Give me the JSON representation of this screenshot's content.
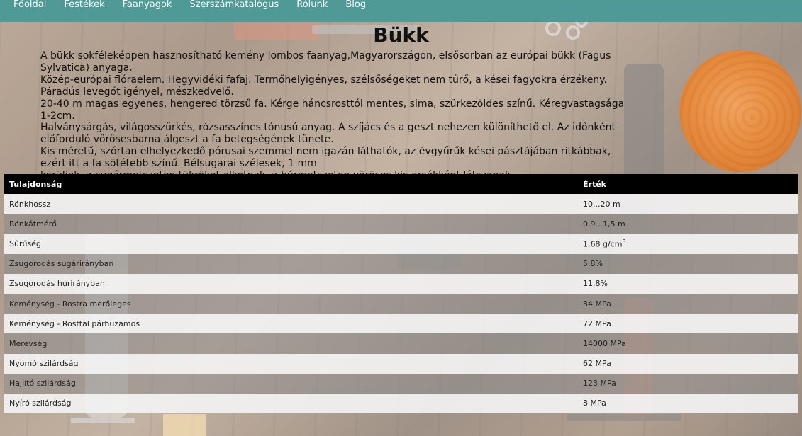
{
  "nav": {
    "items": [
      "Főoldal",
      "Festékek",
      "Faanyagok",
      "Szerszámkatalógus",
      "Rólunk",
      "Blog"
    ]
  },
  "colors": {
    "navbar": "#4f9a96",
    "table_header": "#000000",
    "wood_disc": "#e58a3c"
  },
  "page": {
    "title": "Bükk",
    "paragraphs": [
      "A bükk sokféleképpen hasznosítható kemény lombos faanyag,Magyarországon, elsősorban az európai bükk (Fagus Sylvatica) anyaga.",
      "Közép-európai flóraelem. Hegyvidéki fafaj. Termőhelyigényes, szélsőségeket nem tűrő, a kései fagyokra érzékeny. Páradús levegőt igényel, mészkedvelő.",
      "20-40 m magas egyenes, hengered törzsű fa. Kérge háncsrosttól mentes, sima, szürkezöldes színű. Kéregvastagsága 1-2cm.",
      "Halványsárgás, világosszürkés, rózsasszínes tónusú anyag. A szíjács és a geszt nehezen különíthető el. Az időnként előforduló vörösesbarna álgeszt a fa betegségének tünete.",
      "Kis méretű, szórtan elhelyezkedő pórusai szemmel nem igazán láthatók, az évgyűrűk kései pásztájában ritkábbak, ezért itt a fa sötétebb színű. Bélsugarai szélesek, 1 mm",
      "körüliek, a sugármetszeten tükröket alkotnak, a húrmetszeten vöröses kis orsókként látszanak."
    ],
    "image_alt": "beech-wood-cross-section"
  },
  "table": {
    "headers": [
      "Tulajdonság",
      "Érték"
    ],
    "rows": [
      {
        "prop": "Rönkhossz",
        "value": "10...20 m",
        "sup": ""
      },
      {
        "prop": "Rönkátmérő",
        "value": "0,9...1,5 m",
        "sup": ""
      },
      {
        "prop": "Sűrűség",
        "value": "1,68 g/cm",
        "sup": "3"
      },
      {
        "prop": "Zsugorodás sugárirányban",
        "value": "5,8%",
        "sup": ""
      },
      {
        "prop": "Zsugorodás húrirányban",
        "value": "11,8%",
        "sup": ""
      },
      {
        "prop": "Keménység - Rostra merőleges",
        "value": "34 MPa",
        "sup": ""
      },
      {
        "prop": "Keménység - Rosttal párhuzamos",
        "value": "72 MPa",
        "sup": ""
      },
      {
        "prop": "Merevség",
        "value": "14000 MPa",
        "sup": ""
      },
      {
        "prop": "Nyomó szilárdság",
        "value": "62 MPa",
        "sup": ""
      },
      {
        "prop": "Hajlító szilárdság",
        "value": "123 MPa",
        "sup": ""
      },
      {
        "prop": "Nyíró szilárdság",
        "value": "8 MPa",
        "sup": ""
      }
    ]
  }
}
